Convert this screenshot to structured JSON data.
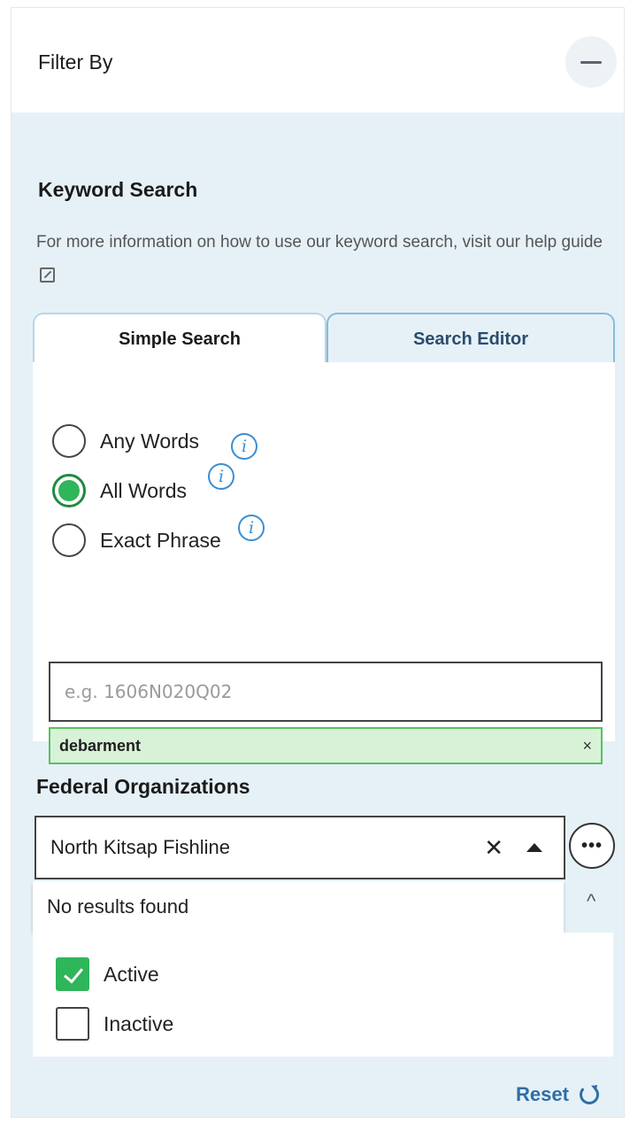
{
  "header": {
    "title": "Filter By"
  },
  "keyword": {
    "title": "Keyword Search",
    "help_text": "For more information on how to use our keyword search, visit our",
    "help_link": "help guide",
    "tabs": [
      {
        "label": "Simple Search",
        "active": true
      },
      {
        "label": "Search Editor",
        "active": false
      }
    ],
    "options": [
      {
        "label": "Any Words",
        "selected": false
      },
      {
        "label": "All Words",
        "selected": true
      },
      {
        "label": "Exact Phrase",
        "selected": false
      }
    ],
    "input": {
      "placeholder": "e.g. 1606N020Q02",
      "value": ""
    },
    "chip": {
      "label": "debarment",
      "remove": "×"
    }
  },
  "federal_orgs": {
    "title": "Federal Organizations",
    "value": "North Kitsap Fishline",
    "clear": "✕",
    "more": "•••",
    "dropdown_message": "No results found",
    "chevron": "^"
  },
  "status": [
    {
      "label": "Active",
      "checked": true
    },
    {
      "label": "Inactive",
      "checked": false
    }
  ],
  "reset_label": "Reset",
  "colors": {
    "accent_green": "#2fb55a",
    "link_blue": "#2d6ea6",
    "info_blue": "#3a8ed4",
    "panel_bg": "#e6f1f7"
  }
}
